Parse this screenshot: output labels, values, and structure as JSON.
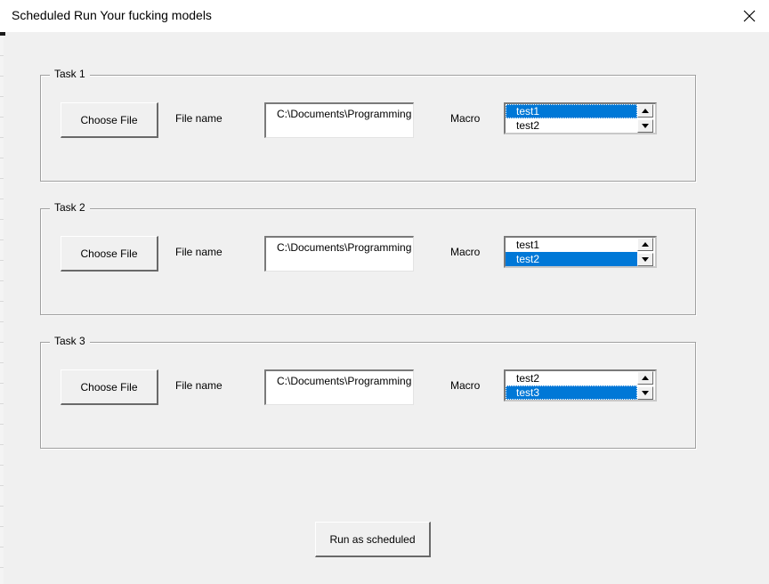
{
  "window": {
    "title": "Scheduled Run Your fucking models"
  },
  "tasks": [
    {
      "label": "Task 1",
      "choose_label": "Choose File",
      "file_label": "File name",
      "file_value": "C:\\Documents\\Programming",
      "macro_label": "Macro",
      "macro_items": [
        "test1",
        "test2"
      ],
      "macro_selected": "test1"
    },
    {
      "label": "Task 2",
      "choose_label": "Choose File",
      "file_label": "File name",
      "file_value": "C:\\Documents\\Programming",
      "macro_label": "Macro",
      "macro_items": [
        "test1",
        "test2"
      ],
      "macro_selected": "test2"
    },
    {
      "label": "Task 3",
      "choose_label": "Choose File",
      "file_label": "File name",
      "file_value": "C:\\Documents\\Programming",
      "macro_label": "Macro",
      "macro_items": [
        "test2",
        "test3"
      ],
      "macro_selected": "test3"
    }
  ],
  "run_button": {
    "label": "Run as scheduled"
  },
  "icons": {
    "close": "close-icon",
    "scroll_up": "arrow-up-icon",
    "scroll_down": "arrow-down-icon"
  },
  "colors": {
    "selection": "#0078d7",
    "dialog_bg": "#f0f0f0"
  }
}
